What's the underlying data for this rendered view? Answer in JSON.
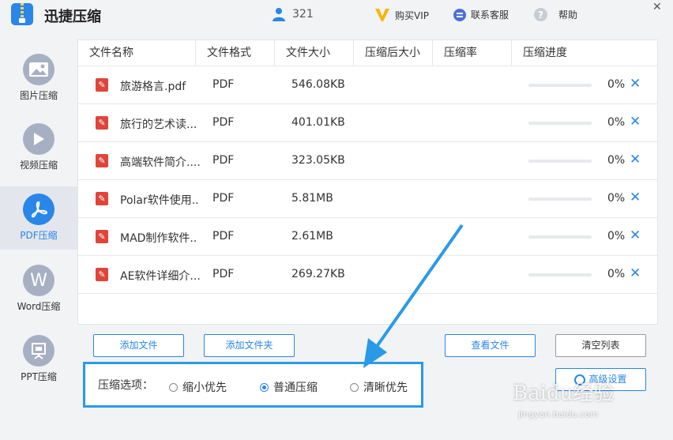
{
  "app": {
    "title": "迅捷压缩"
  },
  "header": {
    "user_count": "321",
    "vip_label": "购买VIP",
    "service_label": "联系客服",
    "help_label": "帮助",
    "close_glyph": "✕"
  },
  "sidebar": {
    "items": [
      {
        "label": "图片压缩",
        "icon": "image-icon",
        "active": false
      },
      {
        "label": "视频压缩",
        "icon": "play-icon",
        "active": false
      },
      {
        "label": "PDF压缩",
        "icon": "pdf-icon",
        "active": true
      },
      {
        "label": "Word压缩",
        "icon": "word-icon",
        "glyph": "W",
        "active": false
      },
      {
        "label": "PPT压缩",
        "icon": "ppt-icon",
        "active": false
      }
    ]
  },
  "table": {
    "columns": [
      "文件名称",
      "文件格式",
      "文件大小",
      "压缩后大小",
      "压缩率",
      "压缩进度"
    ],
    "rows": [
      {
        "name": "旅游格言.pdf",
        "format": "PDF",
        "size": "546.08KB",
        "compressed": "",
        "ratio": "",
        "progress": 0,
        "percent": "0%"
      },
      {
        "name": "旅行的艺术读...",
        "format": "PDF",
        "size": "401.01KB",
        "compressed": "",
        "ratio": "",
        "progress": 0,
        "percent": "0%"
      },
      {
        "name": "高端软件简介....",
        "format": "PDF",
        "size": "323.05KB",
        "compressed": "",
        "ratio": "",
        "progress": 0,
        "percent": "0%"
      },
      {
        "name": "Polar软件使用..",
        "format": "PDF",
        "size": "5.81MB",
        "compressed": "",
        "ratio": "",
        "progress": 0,
        "percent": "0%"
      },
      {
        "name": "MAD制作软件..",
        "format": "PDF",
        "size": "2.61MB",
        "compressed": "",
        "ratio": "",
        "progress": 0,
        "percent": "0%"
      },
      {
        "name": "AE软件详细介...",
        "format": "PDF",
        "size": "269.27KB",
        "compressed": "",
        "ratio": "",
        "progress": 0,
        "percent": "0%"
      }
    ]
  },
  "buttons": {
    "add_file": "添加文件",
    "add_folder": "添加文件夹",
    "view_files": "查看文件",
    "clear_list": "清空列表",
    "advanced": "高级设置"
  },
  "options": {
    "label": "压缩选项：",
    "choices": [
      "缩小优先",
      "普通压缩",
      "清晰优先"
    ],
    "selected": "普通压缩"
  },
  "colors": {
    "accent": "#2a86e8",
    "pdf_red": "#e0453a",
    "highlight_box": "#2a9ae8",
    "vip_gold": "#f5b800"
  },
  "watermark": {
    "text": "Baidu经验",
    "sub": "jingyan.baidu.com"
  }
}
